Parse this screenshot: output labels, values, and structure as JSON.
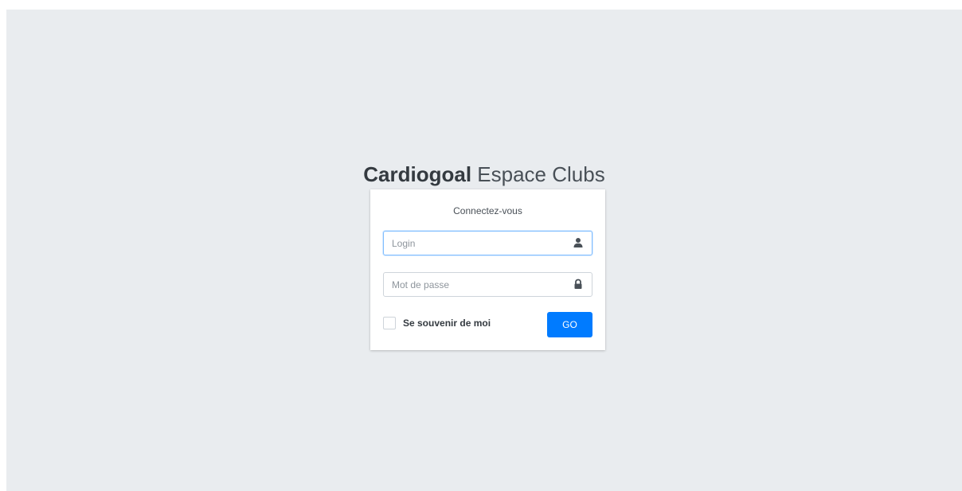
{
  "brand": {
    "name_strong": "Cardiogoal",
    "name_light": "Espace Clubs"
  },
  "login_card": {
    "title": "Connectez-vous",
    "login_field": {
      "placeholder": "Login",
      "value": "",
      "icon": "user-icon"
    },
    "password_field": {
      "placeholder": "Mot de passe",
      "value": "",
      "icon": "lock-icon"
    },
    "remember_me": {
      "label": "Se souvenir de moi",
      "checked": false
    },
    "submit_label": "GO"
  },
  "colors": {
    "background": "#e9ecef",
    "primary": "#007bff",
    "focus_border": "#80bdff"
  }
}
